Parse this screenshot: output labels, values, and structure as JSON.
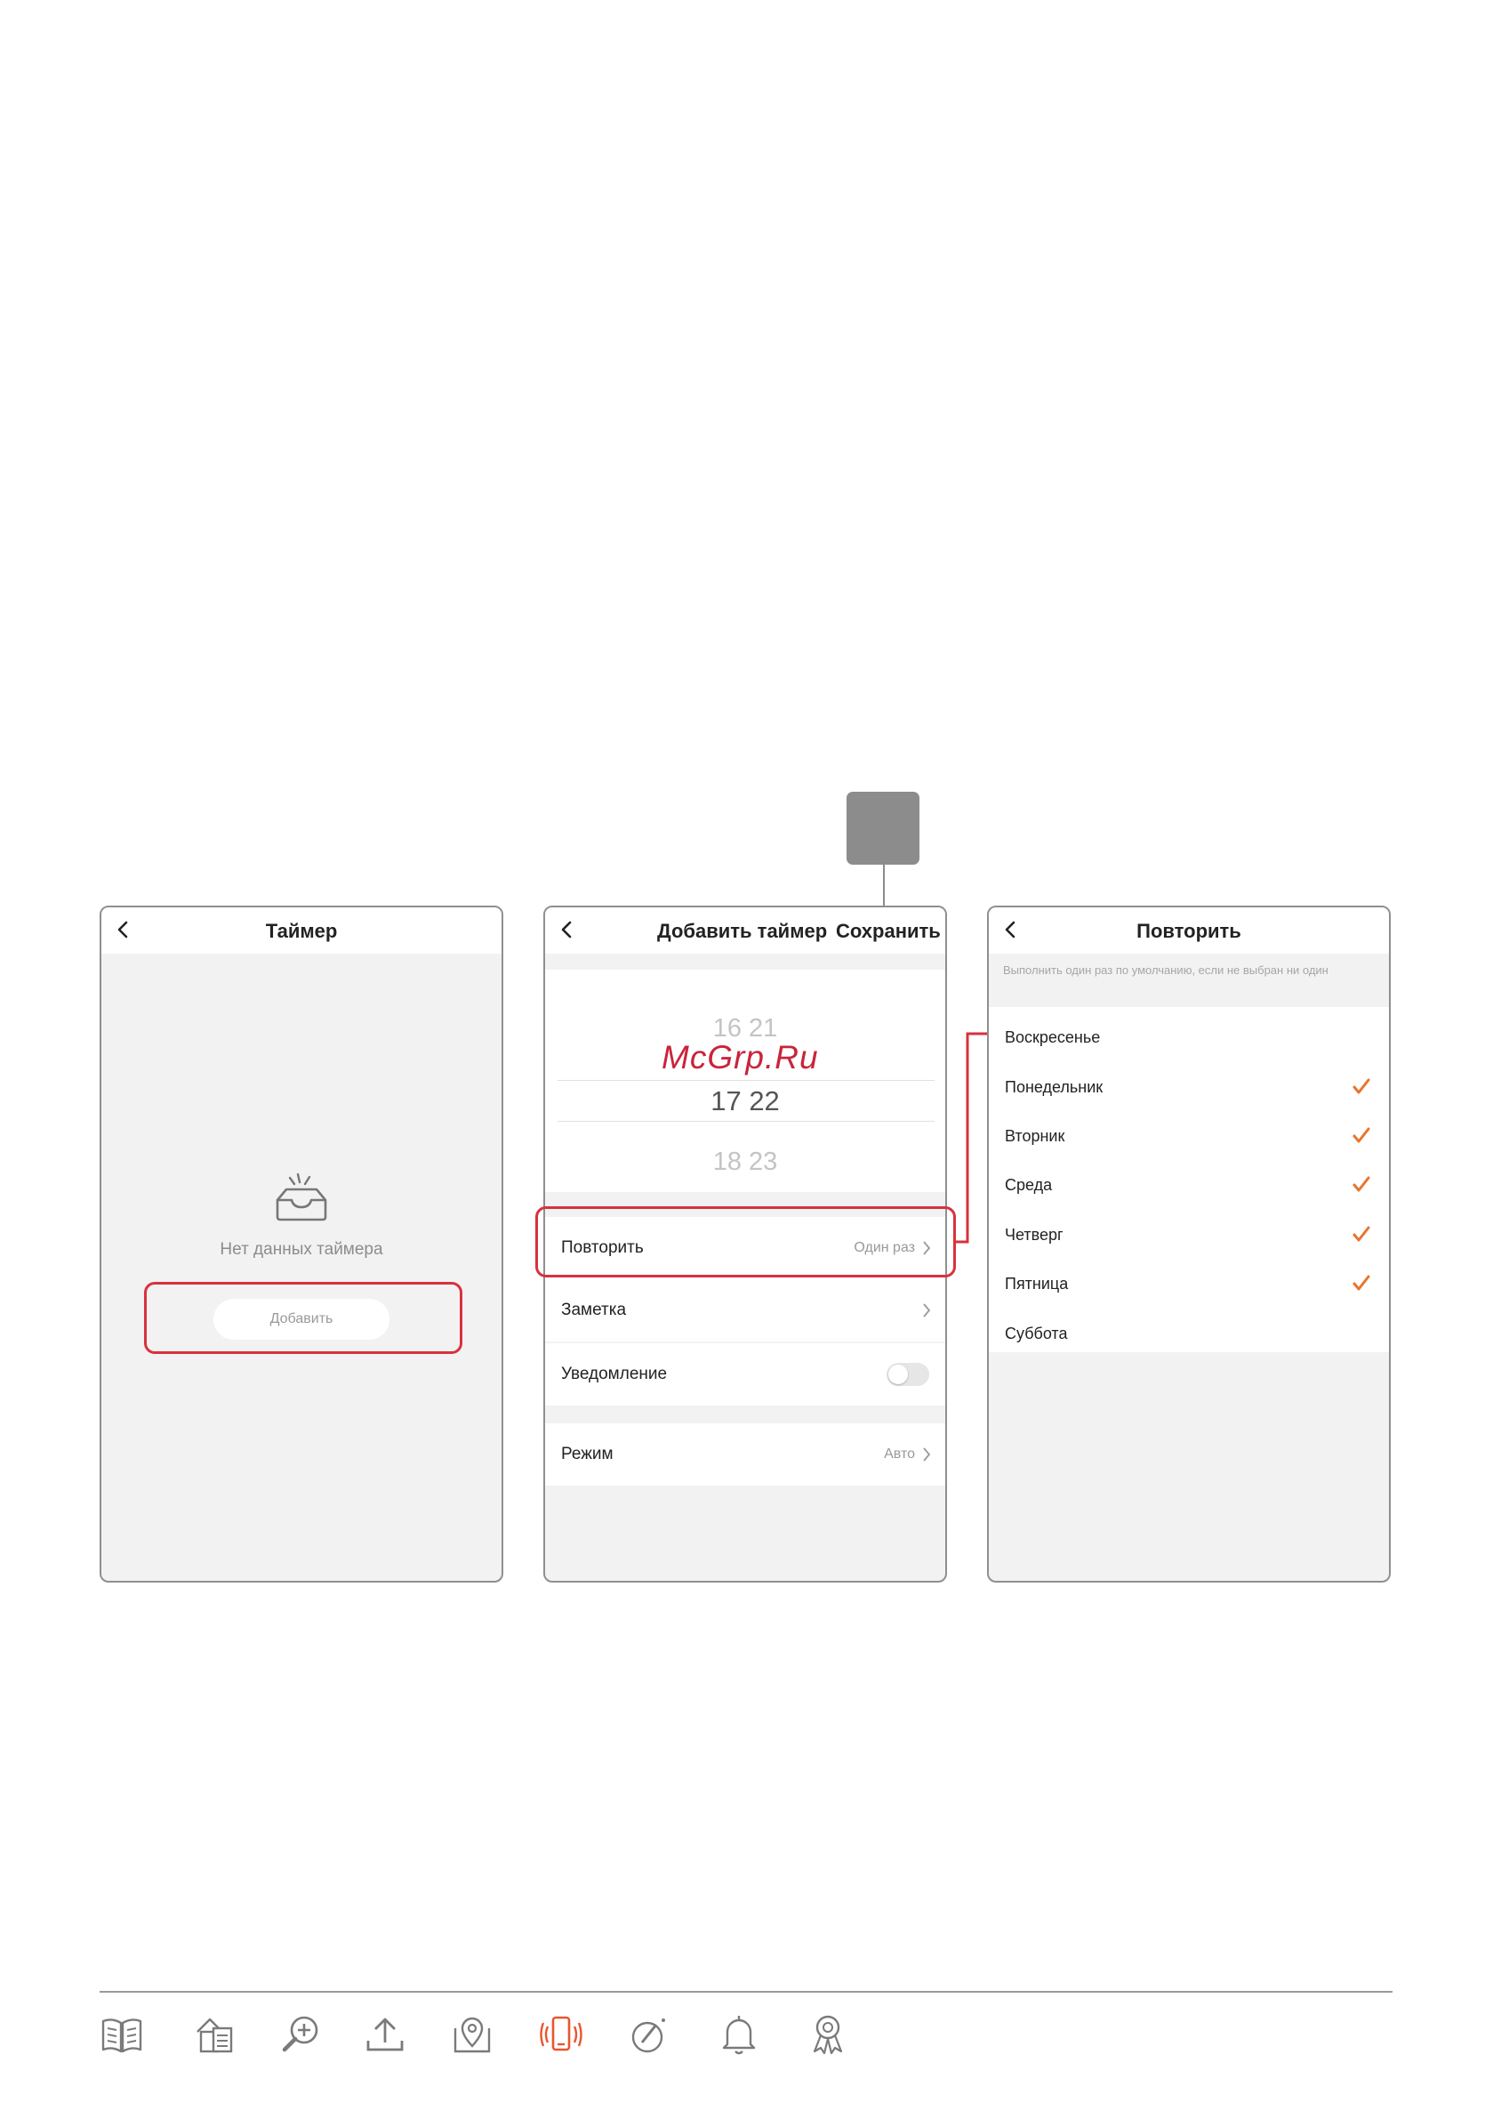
{
  "callout_badge": "",
  "screen1": {
    "title": "Таймер",
    "empty_text": "Нет данных таймера",
    "add_button": "Добавить"
  },
  "screen2": {
    "title": "Добавить таймер",
    "save": "Сохранить",
    "picker": {
      "above": {
        "h": "16",
        "m": "21"
      },
      "selected": {
        "h": "17",
        "m": "22"
      },
      "below": {
        "h": "18",
        "m": "23"
      }
    },
    "repeat_label": "Повторить",
    "repeat_value": "Один раз",
    "note_label": "Заметка",
    "notify_label": "Уведомление",
    "notify_on": false,
    "mode_label": "Режим",
    "mode_value": "Авто"
  },
  "screen3": {
    "title": "Повторить",
    "hint": "Выполнить один раз по умолчанию, если не выбран ни один",
    "days": [
      {
        "label": "Воскресенье",
        "checked": false
      },
      {
        "label": "Понедельник",
        "checked": true
      },
      {
        "label": "Вторник",
        "checked": true
      },
      {
        "label": "Среда",
        "checked": true
      },
      {
        "label": "Четверг",
        "checked": true
      },
      {
        "label": "Пятница",
        "checked": true
      },
      {
        "label": "Суббота",
        "checked": false
      }
    ]
  },
  "watermark": "McGrp.Ru",
  "nav_icons": [
    "manual-book-icon",
    "house-document-icon",
    "zoom-plus-icon",
    "upload-icon",
    "location-pin-icon",
    "vibrating-phone-icon",
    "edit-circle-icon",
    "bell-icon",
    "award-ribbon-icon"
  ],
  "colors": {
    "accent_red": "#d9313d",
    "check_orange": "#e8752e",
    "active_nav": "#e8562e",
    "nav_gray": "#7a7a7a"
  }
}
